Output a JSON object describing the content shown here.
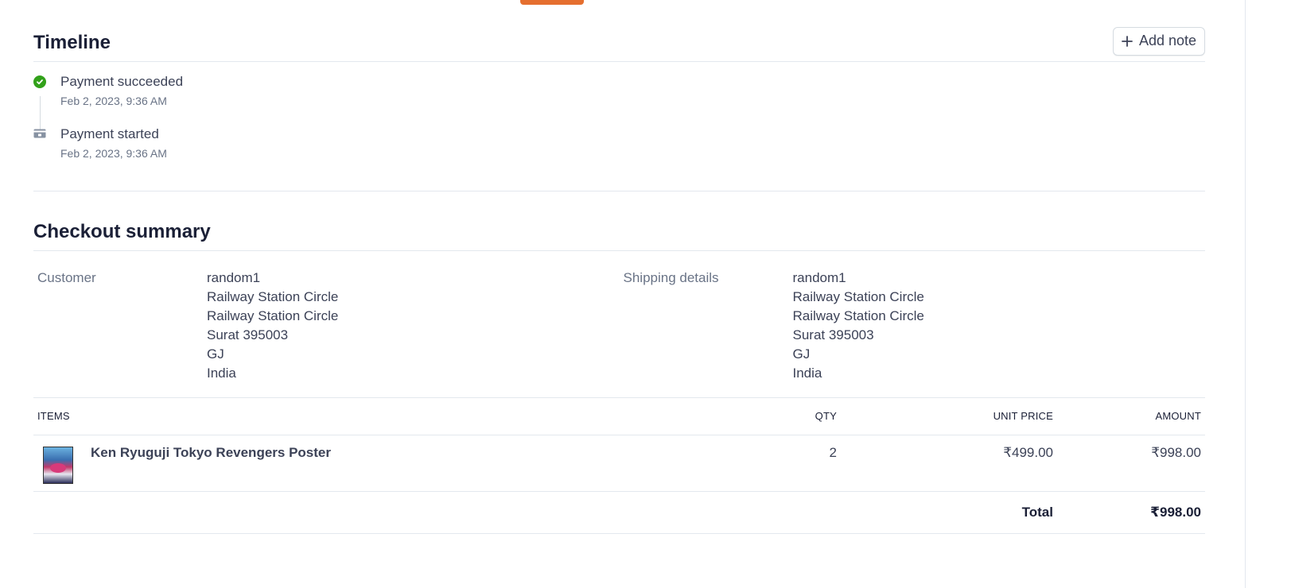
{
  "timeline": {
    "title": "Timeline",
    "add_note_label": "Add note",
    "events": [
      {
        "title": "Payment succeeded",
        "time": "Feb 2, 2023, 9:36 AM",
        "icon": "check-circle-icon",
        "color": "#32a11a"
      },
      {
        "title": "Payment started",
        "time": "Feb 2, 2023, 9:36 AM",
        "icon": "card-icon",
        "color": "#8792a2"
      }
    ]
  },
  "checkout": {
    "title": "Checkout summary",
    "customer": {
      "label": "Customer",
      "lines": [
        "random1",
        "Railway Station Circle",
        "Railway Station Circle",
        "Surat 395003",
        "GJ",
        "India"
      ]
    },
    "shipping": {
      "label": "Shipping details",
      "lines": [
        "random1",
        "Railway Station Circle",
        "Railway Station Circle",
        "Surat 395003",
        "GJ",
        "India"
      ]
    },
    "table": {
      "headers": {
        "items": "ITEMS",
        "qty": "QTY",
        "unit_price": "UNIT PRICE",
        "amount": "AMOUNT"
      },
      "items": [
        {
          "name": "Ken Ryuguji Tokyo Revengers Poster",
          "qty": "2",
          "unit_price": "₹499.00",
          "amount": "₹998.00"
        }
      ],
      "total_label": "Total",
      "total_value": "₹998.00"
    }
  }
}
